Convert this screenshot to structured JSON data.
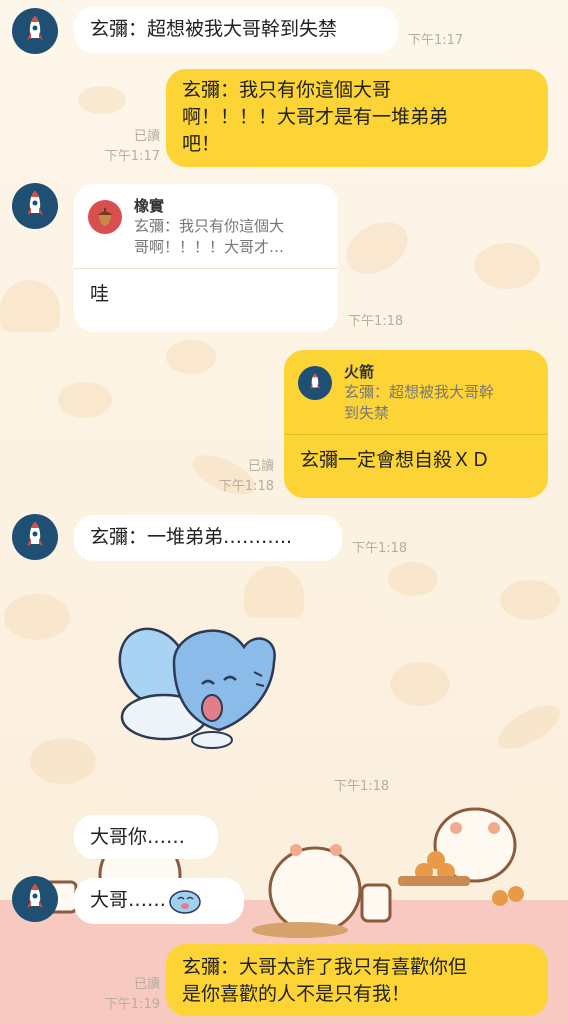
{
  "messages": {
    "m1": {
      "text": "玄彌：超想被我大哥幹到失禁",
      "time": "下午1:17"
    },
    "m2": {
      "text": "玄彌：我只有你這個大哥\n啊！！！！大哥才是有一堆弟弟\n吧！",
      "read": "已讀",
      "time": "下午1:17"
    },
    "m3": {
      "reply_name": "橡實",
      "reply_text": "玄彌：我只有你這個大\n哥啊！！！！大哥才…",
      "text": "哇",
      "time": "下午1:18"
    },
    "m4": {
      "reply_name": "火箭",
      "reply_text": "玄彌：超想被我大哥幹\n到失禁",
      "text": "玄彌一定會想自殺ＸＤ",
      "read": "已讀",
      "time": "下午1:18"
    },
    "m5": {
      "text": "玄彌：一堆弟弟………..",
      "time": "下午1:18"
    },
    "m6": {
      "time": "下午1:18"
    },
    "m7": {
      "text": "大哥你……"
    },
    "m8": {
      "text": "大哥……"
    },
    "m9": {
      "text": "玄彌：大哥太詐了我只有喜歡你但\n是你喜歡的人不是只有我！",
      "read": "已讀",
      "time": "下午1:19"
    }
  },
  "icons": {
    "rocket": "rocket-icon",
    "acorn": "acorn-icon",
    "sticker": "blue-crying-creature-sticker"
  },
  "colors": {
    "outgoing_bubble": "#fcd435",
    "incoming_bubble": "#ffffff",
    "avatar_bg": "#1f4f73",
    "background": "#fdf3e4"
  }
}
